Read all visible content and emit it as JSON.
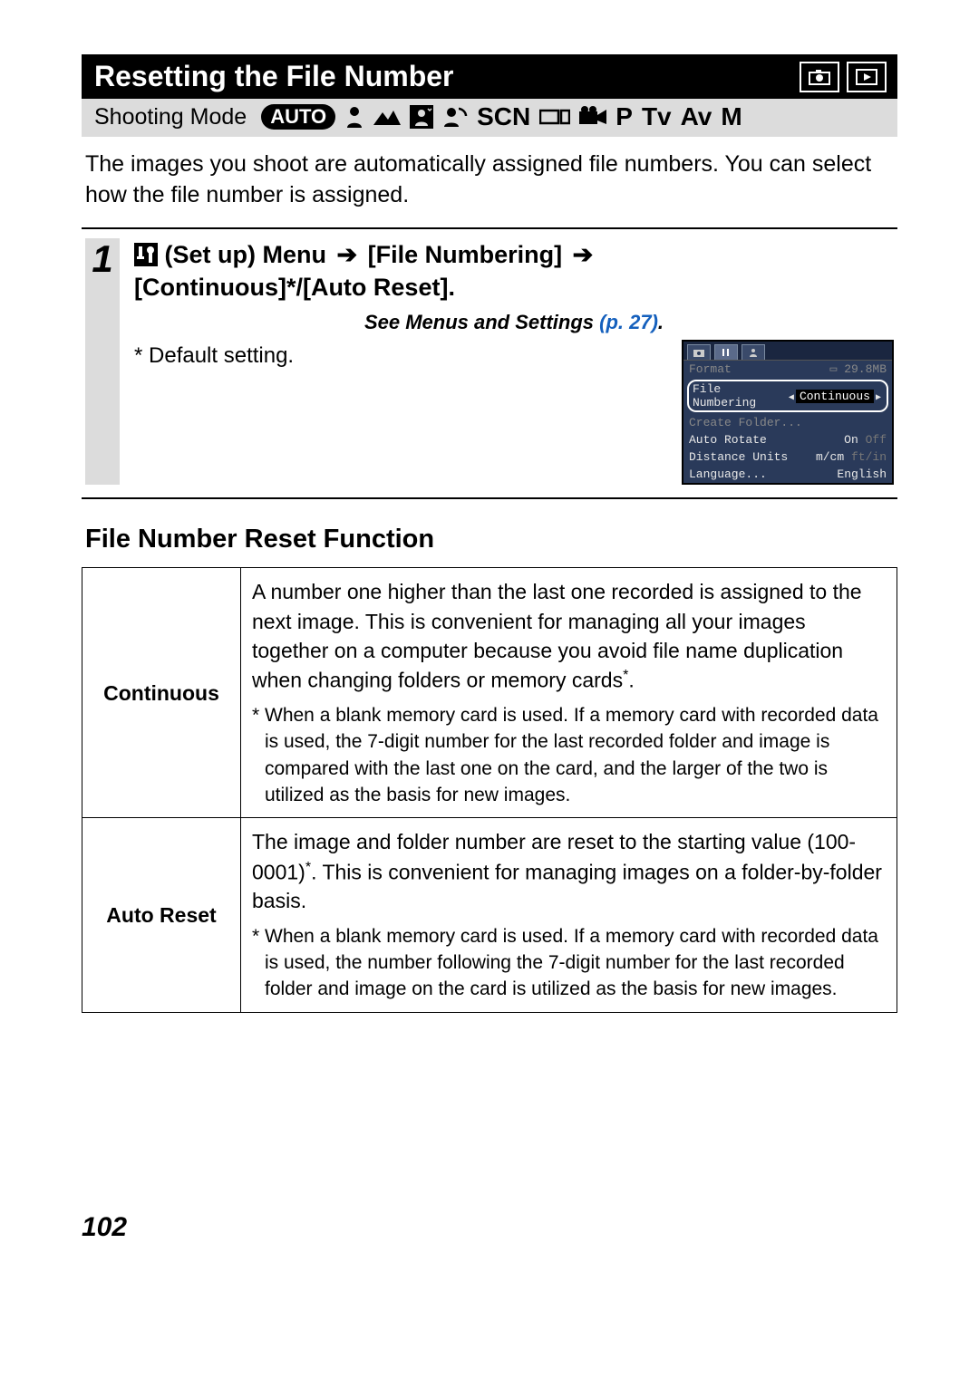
{
  "title": "Resetting the File Number",
  "shooting_mode_label": "Shooting Mode",
  "mode_icons": {
    "auto": "AUTO",
    "scn": "SCN",
    "p": "P",
    "tv": "Tv",
    "av": "Av",
    "m": "M"
  },
  "intro": "The images you shoot are automatically assigned file numbers. You can select how the file number is assigned.",
  "step": {
    "number": "1",
    "menu_label": "(Set up) Menu",
    "item": "[File Numbering]",
    "options": "[Continuous]*/[Auto Reset].",
    "see_text": "See Menus and Settings ",
    "see_ref": "(p. 27)",
    "see_period": ".",
    "default_note": "* Default setting."
  },
  "lcd": {
    "format_label": "Format",
    "format_value": "29.8MB",
    "highlight_label": "File Numbering",
    "highlight_value": "Continuous",
    "create_folder": "Create Folder...",
    "auto_rotate_label": "Auto Rotate",
    "auto_rotate_on": "On",
    "auto_rotate_off": "Off",
    "distance_label": "Distance Units",
    "distance_val1": "m/cm",
    "distance_val2": "ft/in",
    "language_label": "Language...",
    "language_value": "English"
  },
  "section_heading": "File Number Reset Function",
  "table": {
    "continuous_label": "Continuous",
    "continuous_text": "A number one higher than the last one recorded is assigned to the next image. This is convenient for managing all your images together on a computer because you avoid file name duplication when changing folders or memory cards",
    "continuous_star": "*",
    "continuous_note": "* When a blank memory card is used. If a memory card with recorded data is used, the 7-digit number for the last recorded folder and image is compared with the last one on the card, and the larger of the two is utilized as the basis for new images.",
    "autoreset_label": "Auto Reset",
    "autoreset_text_a": "The image and folder number are reset to the starting value (100-0001)",
    "autoreset_star": "*",
    "autoreset_text_b": ". This is convenient for managing images on a folder-by-folder basis.",
    "autoreset_note": "* When a blank memory card is used. If a memory card with recorded data is used, the number following the 7-digit number for the last recorded folder and image on the card is utilized as the basis for new images."
  },
  "page_number": "102"
}
